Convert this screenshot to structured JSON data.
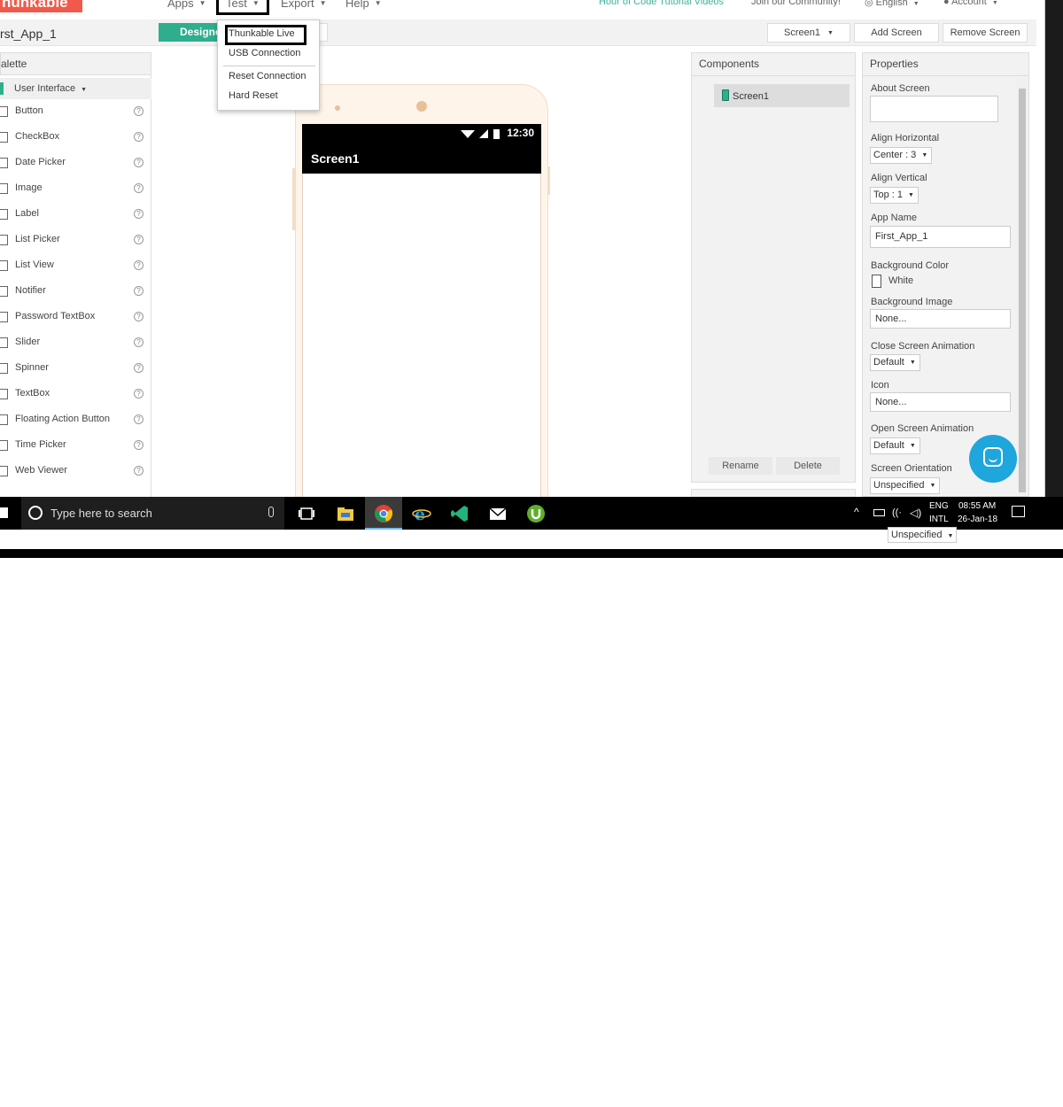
{
  "nav": {
    "logo": "hunkable",
    "menus": [
      {
        "label": "Apps"
      },
      {
        "label": "Test"
      },
      {
        "label": "Export"
      },
      {
        "label": "Help"
      }
    ],
    "tutorial_link": "Hour of Code Tutorial Videos",
    "community_link": "Join our Community!",
    "language": "English",
    "account": "Account"
  },
  "toolbar": {
    "project_name": "rst_App_1",
    "designer_label": "Designer",
    "screen_select": "Screen1",
    "add_screen": "Add Screen",
    "remove_screen": "Remove Screen"
  },
  "test_menu": {
    "items": [
      "Thunkable Live",
      "USB Connection",
      "Reset Connection",
      "Hard Reset"
    ]
  },
  "palette": {
    "header": "alette",
    "category": "User Interface",
    "items": [
      {
        "label": "Button"
      },
      {
        "label": "CheckBox"
      },
      {
        "label": "Date Picker"
      },
      {
        "label": "Image"
      },
      {
        "label": "Label"
      },
      {
        "label": "List Picker"
      },
      {
        "label": "List View"
      },
      {
        "label": "Notifier"
      },
      {
        "label": "Password TextBox"
      },
      {
        "label": "Slider"
      },
      {
        "label": "Spinner"
      },
      {
        "label": "TextBox"
      },
      {
        "label": "Floating Action Button"
      },
      {
        "label": "Time Picker"
      },
      {
        "label": "Web Viewer"
      }
    ],
    "help_glyph": "?"
  },
  "phone": {
    "status_time": "12:30",
    "screen_title": "Screen1"
  },
  "components": {
    "header": "Components",
    "tree_item": "Screen1",
    "rename": "Rename",
    "delete": "Delete"
  },
  "properties": {
    "header": "Properties",
    "about_screen": "About Screen",
    "align_horizontal": "Align Horizontal",
    "align_horizontal_value": "Center : 3",
    "align_vertical": "Align Vertical",
    "align_vertical_value": "Top : 1",
    "app_name": "App Name",
    "app_name_value": "First_App_1",
    "background_color": "Background Color",
    "background_color_value": "White",
    "background_image": "Background Image",
    "background_image_value": "None...",
    "close_screen_animation": "Close Screen Animation",
    "close_screen_animation_value": "Default",
    "icon": "Icon",
    "icon_value": "None...",
    "open_screen_animation": "Open Screen Animation",
    "open_screen_animation_value": "Default",
    "screen_orientation": "Screen Orientation",
    "screen_orientation_value": "Unspecified"
  },
  "taskbar": {
    "search_placeholder": "Type here to search",
    "lang_line1": "ENG",
    "lang_line2": "INTL",
    "time": "08:55 AM",
    "date": "26-Jan-18"
  },
  "colors": {
    "brand": "#f15a4a",
    "accent_green": "#2eae8c",
    "chat_blue": "#1fa6dc"
  }
}
